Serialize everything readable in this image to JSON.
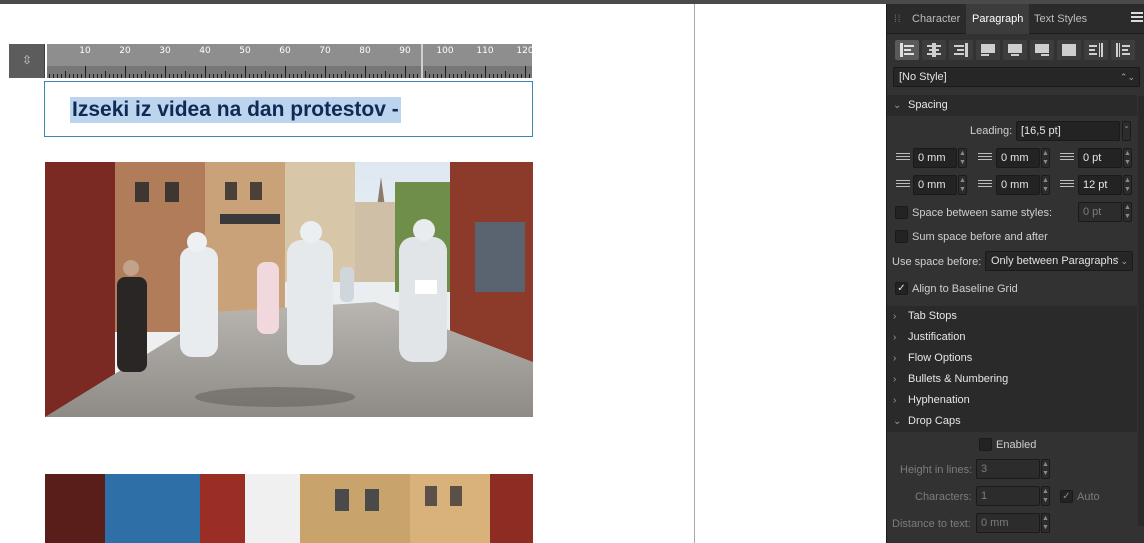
{
  "document": {
    "heading": "Izseki iz videa na dan protestov -",
    "ruler_labels": [
      "10",
      "20",
      "30",
      "40",
      "50",
      "60",
      "70",
      "80",
      "90",
      "100",
      "110",
      "120"
    ]
  },
  "panel": {
    "tabs": [
      {
        "label": "Character",
        "active": false
      },
      {
        "label": "Paragraph",
        "active": true
      },
      {
        "label": "Text Styles",
        "active": false
      }
    ],
    "alignment_buttons": [
      "align-left-icon",
      "align-center-icon",
      "align-right-icon",
      "justify-left-icon",
      "justify-center-icon",
      "justify-right-icon",
      "justify-all-icon",
      "align-towards-spine-icon",
      "align-away-from-spine-icon"
    ],
    "paragraph_style": "[No Style]",
    "spacing": {
      "title": "Spacing",
      "leading_label": "Leading:",
      "leading_value": "[16,5 pt]",
      "left_indent": "0 mm",
      "first_line_indent": "0 mm",
      "space_before": "0 pt",
      "right_indent": "0 mm",
      "last_line_indent": "0 mm",
      "space_after": "12 pt",
      "space_between_same_styles_label": "Space between same styles:",
      "space_between_same_styles_value": "0 pt",
      "space_between_same_styles_checked": false,
      "sum_space_label": "Sum space before and after",
      "sum_space_checked": false,
      "use_space_before_label": "Use space before:",
      "use_space_before_value": "Only between Paragraphs",
      "align_baseline_label": "Align to Baseline Grid",
      "align_baseline_checked": true
    },
    "sections": [
      "Tab Stops",
      "Justification",
      "Flow Options",
      "Bullets & Numbering",
      "Hyphenation"
    ],
    "drop_caps": {
      "title": "Drop Caps",
      "enabled_label": "Enabled",
      "enabled_checked": false,
      "height_label": "Height in lines:",
      "height_value": "3",
      "characters_label": "Characters:",
      "characters_value": "1",
      "auto_label": "Auto",
      "auto_checked": true,
      "distance_label": "Distance to text:",
      "distance_value": "0 mm"
    }
  },
  "colors": {
    "panel_bg": "#323232",
    "heading_text": "#0f2a55",
    "text_selection": "#bcd4ee",
    "frame_border": "#3d86b4"
  }
}
